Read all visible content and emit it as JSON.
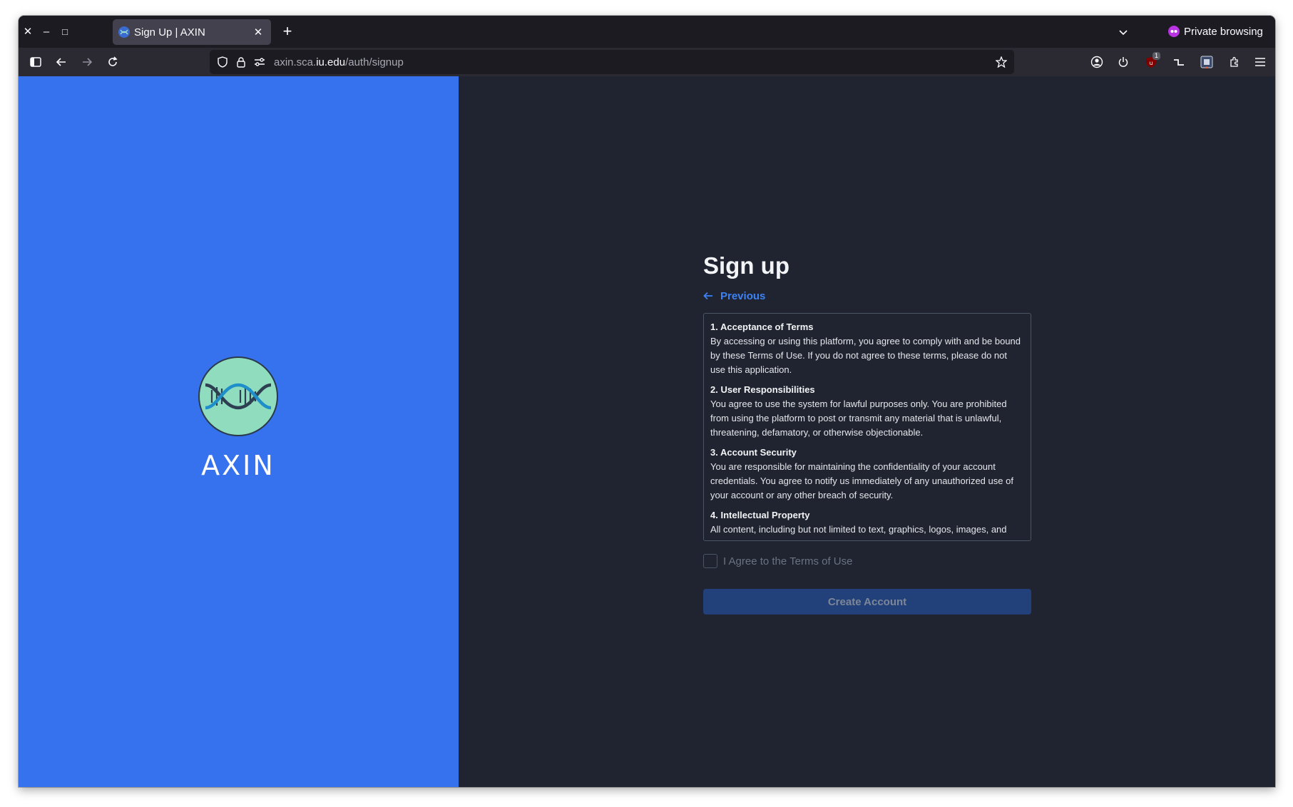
{
  "browser": {
    "window_controls": {
      "close": "✕",
      "minimize": "–",
      "maximize": "□"
    },
    "tab": {
      "title": "Sign Up | AXIN",
      "close": "✕"
    },
    "new_tab": "+",
    "private_label": "Private browsing",
    "url": {
      "prefix": "axin.sca.",
      "host": "iu.edu",
      "path": "/auth/signup"
    },
    "extension_badge": "1"
  },
  "brand": {
    "name": "AXIN",
    "logo_colors": [
      "#8fdcbf",
      "#2a3a4a",
      "#1f8ec9"
    ]
  },
  "page": {
    "title": "Sign up",
    "previous_label": "Previous",
    "terms": [
      {
        "heading": "1. Acceptance of Terms",
        "body": "By accessing or using this platform, you agree to comply with and be bound by these Terms of Use. If you do not agree to these terms, please do not use this application."
      },
      {
        "heading": "2. User Responsibilities",
        "body": "You agree to use the system for lawful purposes only. You are prohibited from using the platform to post or transmit any material that is unlawful, threatening, defamatory, or otherwise objectionable."
      },
      {
        "heading": "3. Account Security",
        "body": "You are responsible for maintaining the confidentiality of your account credentials. You agree to notify us immediately of any unauthorized use of your account or any other breach of security."
      },
      {
        "heading": "4. Intellectual Property",
        "body": "All content, including but not limited to text, graphics, logos, images, and"
      }
    ],
    "agree_label": "I Agree to the Terms of Use",
    "agree_checked": false,
    "create_button": "Create Account"
  },
  "colors": {
    "left_panel": "#3672ed",
    "right_panel": "#1f2430",
    "accent": "#3b82f6",
    "button_disabled": "#22407a"
  }
}
